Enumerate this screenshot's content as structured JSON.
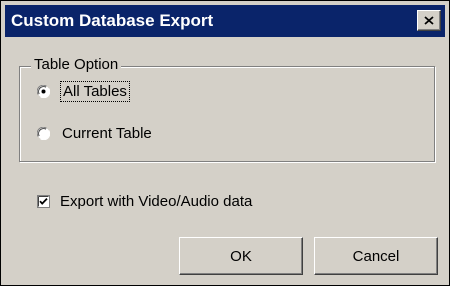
{
  "window": {
    "title": "Custom Database Export",
    "colors": {
      "titlebar": "#0a246a",
      "face": "#d4d0c8"
    }
  },
  "titlebar": {
    "close_icon": "close-icon"
  },
  "table_option": {
    "legend": "Table Option",
    "options": [
      {
        "label": "All Tables",
        "selected": true,
        "focused": true
      },
      {
        "label": "Current Table",
        "selected": false,
        "focused": false
      }
    ]
  },
  "export_media": {
    "label": "Export with Video/Audio data",
    "checked": true
  },
  "buttons": {
    "ok_label": "OK",
    "cancel_label": "Cancel"
  }
}
